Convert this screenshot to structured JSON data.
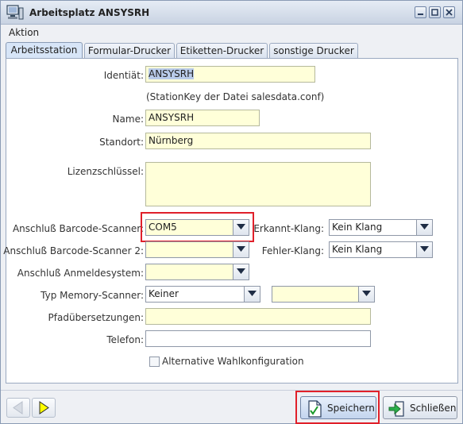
{
  "window": {
    "title": "Arbeitsplatz ANSYSRH"
  },
  "menu": {
    "action_label": "Aktion"
  },
  "tabs": [
    {
      "label": "Arbeitsstation",
      "active": true
    },
    {
      "label": "Formular-Drucker",
      "active": false
    },
    {
      "label": "Etiketten-Drucker",
      "active": false
    },
    {
      "label": "sonstige Drucker",
      "active": false
    }
  ],
  "form": {
    "identity": {
      "label": "Identiät:",
      "value": "ANSYSRH"
    },
    "stationkey_note": "(StationKey der Datei salesdata.conf)",
    "name": {
      "label": "Name:",
      "value": "ANSYSRH"
    },
    "location": {
      "label": "Standort:",
      "value": "Nürnberg"
    },
    "license_key": {
      "label": "Lizenzschlüssel:",
      "value": ""
    },
    "barcode_scanner": {
      "label": "Anschluß Barcode-Scanner:",
      "value": "COM5"
    },
    "barcode_scanner_2": {
      "label": "Anschluß Barcode-Scanner 2:",
      "value": ""
    },
    "login_system": {
      "label": "Anschluß Anmeldesystem:",
      "value": ""
    },
    "memory_scanner_type": {
      "label": "Typ Memory-Scanner:",
      "value": "Keiner",
      "extra_value": ""
    },
    "path_translations": {
      "label": "Pfadübersetzungen:",
      "value": ""
    },
    "phone": {
      "label": "Telefon:",
      "value": ""
    },
    "recognized_sound": {
      "label": "Erkannt-Klang:",
      "value": "Kein Klang"
    },
    "error_sound": {
      "label": "Fehler-Klang:",
      "value": "Kein Klang"
    },
    "alt_dial_config": {
      "label": "Alternative Wahlkonfiguration",
      "checked": false
    }
  },
  "buttons": {
    "save_label": "Speichern",
    "close_label": "Schließen"
  },
  "colors": {
    "field_bg": "#ffffd9",
    "highlight": "#e0202a",
    "nav_arrow_active": "#ffff00"
  }
}
